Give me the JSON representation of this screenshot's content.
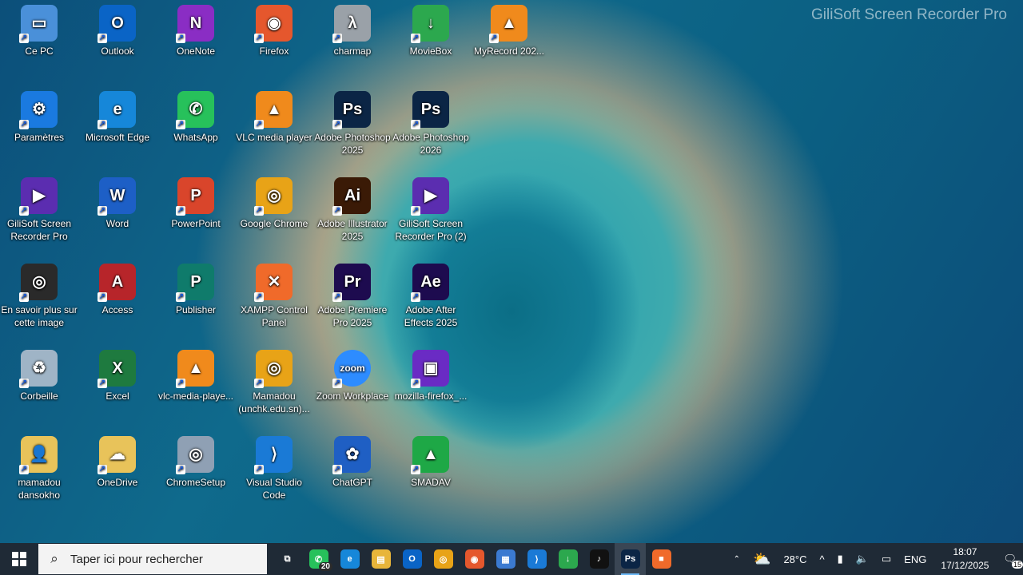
{
  "watermark": "GiliSoft Screen Recorder Pro",
  "desktop": {
    "icons": [
      {
        "label": "Ce PC",
        "icon": "computer-icon",
        "color": "#4a90d9",
        "glyph": "▭"
      },
      {
        "label": "Outlook",
        "icon": "outlook-icon",
        "color": "#0a64c6",
        "glyph": "O"
      },
      {
        "label": "OneNote",
        "icon": "onenote-icon",
        "color": "#8a2dc4",
        "glyph": "N"
      },
      {
        "label": "Firefox",
        "icon": "firefox-icon",
        "color": "#e5572d",
        "glyph": "◉"
      },
      {
        "label": "charmap",
        "icon": "charmap-icon",
        "color": "#9aa1a8",
        "glyph": "λ"
      },
      {
        "label": "MovieBox",
        "icon": "moviebox-icon",
        "color": "#2ca84e",
        "glyph": "↓"
      },
      {
        "label": "MyRecord 202...",
        "icon": "vlc-icon",
        "color": "#f08a1c",
        "glyph": "▲"
      },
      {
        "label": "Paramètres",
        "icon": "settings-icon",
        "color": "#1a7ae0",
        "glyph": "⚙"
      },
      {
        "label": "Microsoft Edge",
        "icon": "edge-icon",
        "color": "#1687d9",
        "glyph": "e"
      },
      {
        "label": "WhatsApp",
        "icon": "whatsapp-icon",
        "color": "#27c15b",
        "glyph": "✆"
      },
      {
        "label": "VLC media player",
        "icon": "vlc-icon",
        "color": "#f08a1c",
        "glyph": "▲"
      },
      {
        "label": "Adobe Photoshop 2025",
        "icon": "photoshop-icon",
        "color": "#0b2545",
        "glyph": "Ps"
      },
      {
        "label": "Adobe Photoshop 2026",
        "icon": "photoshop-icon",
        "color": "#0b2545",
        "glyph": "Ps"
      },
      {
        "label": "GiliSoft Screen Recorder Pro",
        "icon": "gilisoft-icon",
        "color": "#5b2db0",
        "glyph": "▶"
      },
      {
        "label": "Word",
        "icon": "word-icon",
        "color": "#1d5fc6",
        "glyph": "W"
      },
      {
        "label": "PowerPoint",
        "icon": "powerpoint-icon",
        "color": "#d9452b",
        "glyph": "P"
      },
      {
        "label": "Google Chrome",
        "icon": "chrome-icon",
        "color": "#e8a317",
        "glyph": "◎"
      },
      {
        "label": "Adobe Illustrator 2025",
        "icon": "illustrator-icon",
        "color": "#3a1a06",
        "glyph": "Ai"
      },
      {
        "label": "GiliSoft Screen Recorder Pro (2)",
        "icon": "gilisoft-icon",
        "color": "#5b2db0",
        "glyph": "▶"
      },
      {
        "label": "En savoir plus sur cette image",
        "icon": "camera-info-icon",
        "color": "#2a2a2a",
        "glyph": "◎"
      },
      {
        "label": "Access",
        "icon": "access-icon",
        "color": "#b7252a",
        "glyph": "A"
      },
      {
        "label": "Publisher",
        "icon": "publisher-icon",
        "color": "#0f7b6b",
        "glyph": "P"
      },
      {
        "label": "XAMPP Control Panel",
        "icon": "xampp-icon",
        "color": "#f06a2a",
        "glyph": "✕"
      },
      {
        "label": "Adobe Premiere Pro 2025",
        "icon": "premiere-icon",
        "color": "#1d0b4f",
        "glyph": "Pr"
      },
      {
        "label": "Adobe After Effects 2025",
        "icon": "aftereffects-icon",
        "color": "#1d0b4f",
        "glyph": "Ae"
      },
      {
        "label": "Corbeille",
        "icon": "recycle-bin-icon",
        "color": "#9fb4c6",
        "glyph": "♻"
      },
      {
        "label": "Excel",
        "icon": "excel-icon",
        "color": "#1e7a3f",
        "glyph": "X"
      },
      {
        "label": "vlc-media-playe...",
        "icon": "vlc-icon",
        "color": "#f08a1c",
        "glyph": "▲"
      },
      {
        "label": "Mamadou (unchk.edu.sn)...",
        "icon": "chrome-profile-icon",
        "color": "#e8a317",
        "glyph": "◎"
      },
      {
        "label": "Zoom Workplace",
        "icon": "zoom-icon",
        "color": "#2d8cff",
        "glyph": "zoom"
      },
      {
        "label": "mozilla-firefox_...",
        "icon": "firefox-package-icon",
        "color": "#6a2bc4",
        "glyph": "▣"
      },
      {
        "label": "mamadou dansokho",
        "icon": "user-folder-icon",
        "color": "#e8c35a",
        "glyph": "👤"
      },
      {
        "label": "OneDrive",
        "icon": "onedrive-icon",
        "color": "#e8c35a",
        "glyph": "☁"
      },
      {
        "label": "ChromeSetup",
        "icon": "setup-disc-icon",
        "color": "#8fa0b4",
        "glyph": "◎"
      },
      {
        "label": "Visual Studio Code",
        "icon": "vscode-icon",
        "color": "#1a7ad6",
        "glyph": "⟩"
      },
      {
        "label": "ChatGPT",
        "icon": "chatgpt-icon",
        "color": "#1f5fc4",
        "glyph": "✿"
      },
      {
        "label": "SMADAV",
        "icon": "smadav-icon",
        "color": "#1ea846",
        "glyph": "▲"
      }
    ]
  },
  "taskbar": {
    "search_placeholder": "Taper ici pour rechercher",
    "apps": [
      {
        "name": "task-view",
        "glyph": "⧉",
        "color": "#1f2a36"
      },
      {
        "name": "whatsapp",
        "glyph": "✆",
        "color": "#27c15b",
        "badge": "20"
      },
      {
        "name": "edge",
        "glyph": "e",
        "color": "#1687d9"
      },
      {
        "name": "file-explorer",
        "glyph": "▤",
        "color": "#e8b53a"
      },
      {
        "name": "outlook",
        "glyph": "O",
        "color": "#0a64c6"
      },
      {
        "name": "chrome",
        "glyph": "◎",
        "color": "#e8a317"
      },
      {
        "name": "firefox",
        "glyph": "◉",
        "color": "#e5572d"
      },
      {
        "name": "store",
        "glyph": "▦",
        "color": "#3b7ad1"
      },
      {
        "name": "vscode",
        "glyph": "⟩",
        "color": "#1a7ad6"
      },
      {
        "name": "moviebox",
        "glyph": "↓",
        "color": "#2ca84e"
      },
      {
        "name": "tiktok",
        "glyph": "♪",
        "color": "#111111"
      },
      {
        "name": "photoshop",
        "glyph": "Ps",
        "color": "#0b2545",
        "active": true
      },
      {
        "name": "recorder",
        "glyph": "■",
        "color": "#f06a2a"
      }
    ],
    "weather": "28°C",
    "language": "ENG",
    "time": "18:07",
    "date": "17/12/2025",
    "notifications": "15"
  }
}
